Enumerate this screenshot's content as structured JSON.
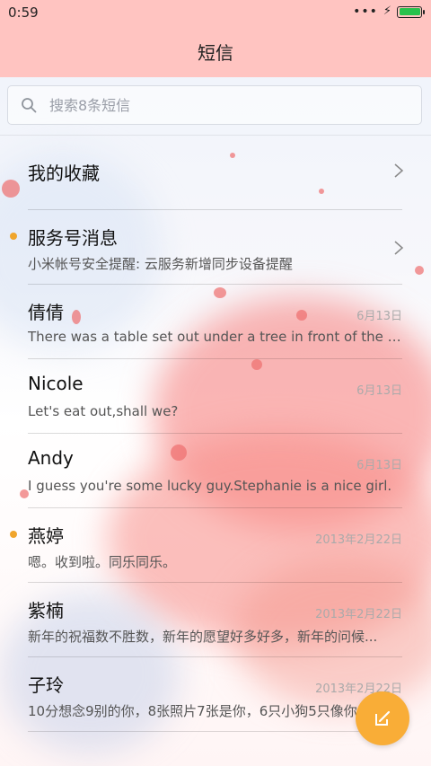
{
  "status_bar": {
    "time": "0:59",
    "signal_icon": "more-dots-icon",
    "charging_icon": "bolt-icon",
    "battery_level": 1.0
  },
  "header": {
    "title": "短信"
  },
  "search": {
    "placeholder": "搜索8条短信"
  },
  "conversations": [
    {
      "name": "我的收藏",
      "preview": "",
      "date": "",
      "unread": false,
      "chevron": true
    },
    {
      "name": "服务号消息",
      "preview": "小米帐号安全提醒: 云服务新增同步设备提醒",
      "date": "",
      "unread": true,
      "chevron": true
    },
    {
      "name": "倩倩",
      "preview": "There was a table set out under a tree in front of the ho...",
      "date": "6月13日",
      "unread": false,
      "chevron": false
    },
    {
      "name": "Nicole",
      "preview": "Let's eat out,shall we?",
      "date": "6月13日",
      "unread": false,
      "chevron": false
    },
    {
      "name": "Andy",
      "preview": "I guess you're some lucky guy.Stephanie is a nice girl.",
      "date": "6月13日",
      "unread": false,
      "chevron": false
    },
    {
      "name": "燕婷",
      "preview": "嗯。收到啦。同乐同乐。",
      "date": "2013年2月22日",
      "unread": true,
      "chevron": false
    },
    {
      "name": "紫楠",
      "preview": "新年的祝福数不胜数，新年的愿望好多好多，新年的问候...",
      "date": "2013年2月22日",
      "unread": false,
      "chevron": false
    },
    {
      "name": "子玲",
      "preview": "10分想念9别的你，8张照片7张是你，6只小狗5只像你",
      "date": "2013年2月22日",
      "unread": false,
      "chevron": false
    }
  ],
  "fab": {
    "icon": "compose-icon"
  },
  "colors": {
    "header_bg": "#ffc4c1",
    "unread_dot": "#f0a52c",
    "fab_bg": "#f9ad37"
  }
}
